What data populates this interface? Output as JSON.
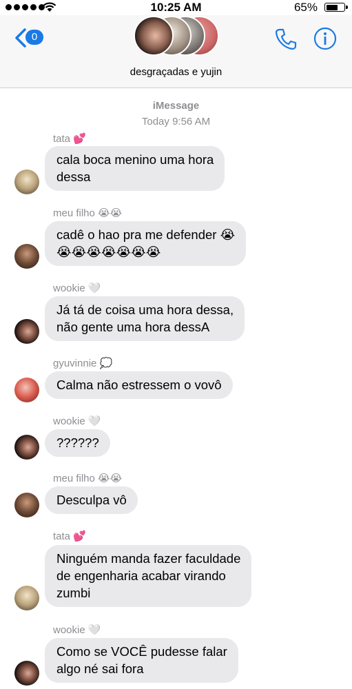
{
  "status_bar": {
    "time": "10:25 AM",
    "battery_percent": "65%",
    "battery_level": 0.65,
    "signal_bars": 5
  },
  "header": {
    "back_count": "0",
    "group_name": "desgraçadas e yujin",
    "icons": [
      "back-chevron-icon",
      "phone-icon",
      "info-icon"
    ]
  },
  "meta": {
    "service": "iMessage",
    "timestamp": "Today 9:56 AM"
  },
  "messages": [
    {
      "sender": "tata",
      "sender_emoji": "💕",
      "lines": [
        "cala boca menino uma hora",
        "dessa"
      ]
    },
    {
      "sender": "meu filho",
      "sender_emoji": "😭😭",
      "lines": [
        "cadê o hao pra me defender 😭",
        "😭😭😭😭😭😭😭"
      ]
    },
    {
      "sender": "wookie",
      "sender_emoji": "🤍",
      "lines": [
        "Já tá de coisa uma hora dessa,",
        "não gente uma hora dessA"
      ]
    },
    {
      "sender": "gyuvinnie",
      "sender_emoji": "💭",
      "lines": [
        "Calma não estressem o vovô"
      ]
    },
    {
      "sender": "wookie",
      "sender_emoji": "🤍",
      "lines": [
        "??????"
      ]
    },
    {
      "sender": "meu filho",
      "sender_emoji": "😭😭",
      "lines": [
        "Desculpa vô"
      ]
    },
    {
      "sender": "tata",
      "sender_emoji": "💕",
      "lines": [
        "Ninguém manda fazer faculdade",
        "de engenharia acabar virando",
        "zumbi"
      ]
    },
    {
      "sender": "wookie",
      "sender_emoji": "🤍",
      "lines": [
        "Como se VOCÊ pudesse falar",
        "algo né sai fora"
      ]
    }
  ],
  "colors": {
    "accent": "#1a7ae6",
    "bubble": "#e9e9eb",
    "meta_text": "#8e8e93",
    "heart_pink": "#e8479a"
  }
}
